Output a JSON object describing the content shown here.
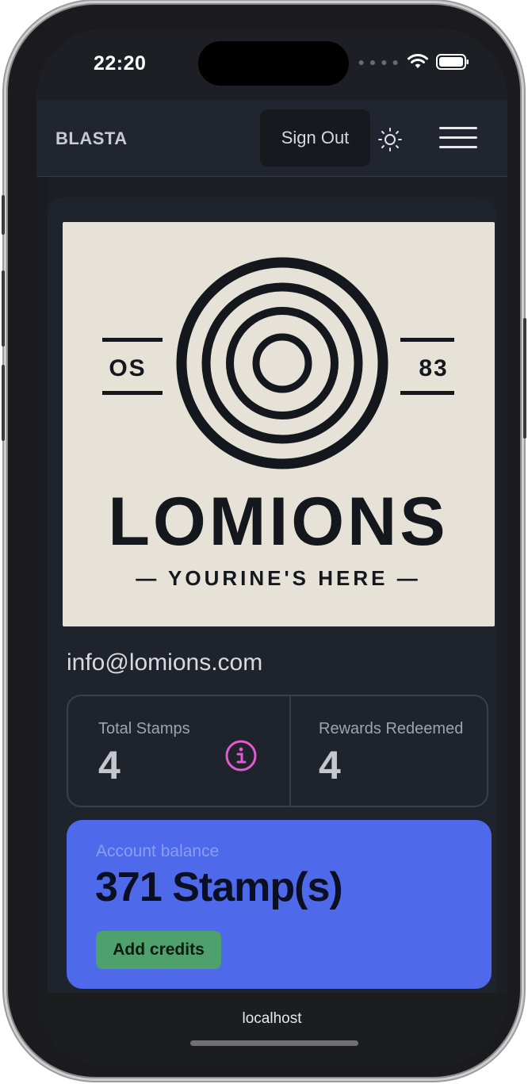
{
  "status_bar": {
    "time": "22:20"
  },
  "nav": {
    "brand": "BLASTA",
    "sign_out_label": "Sign Out"
  },
  "business": {
    "logo": {
      "left_tag": "OS",
      "right_tag": "83",
      "name": "LOMIONS",
      "tagline": "— YOURINE'S HERE —"
    },
    "email": "info@lomions.com"
  },
  "stats": {
    "total_stamps_label": "Total Stamps",
    "total_stamps_value": "4",
    "rewards_redeemed_label": "Rewards Redeemed",
    "rewards_redeemed_value": "4"
  },
  "balance": {
    "label": "Account balance",
    "value": "371 Stamp(s)",
    "add_credits_label": "Add credits"
  },
  "browser": {
    "url": "localhost"
  },
  "colors": {
    "page_bg": "#1d1f25",
    "balance_card": "#4e6aeb",
    "add_credits_button": "#4ea06c",
    "info_icon": "#e05ad0",
    "logo_bg": "#e6e2d8"
  }
}
